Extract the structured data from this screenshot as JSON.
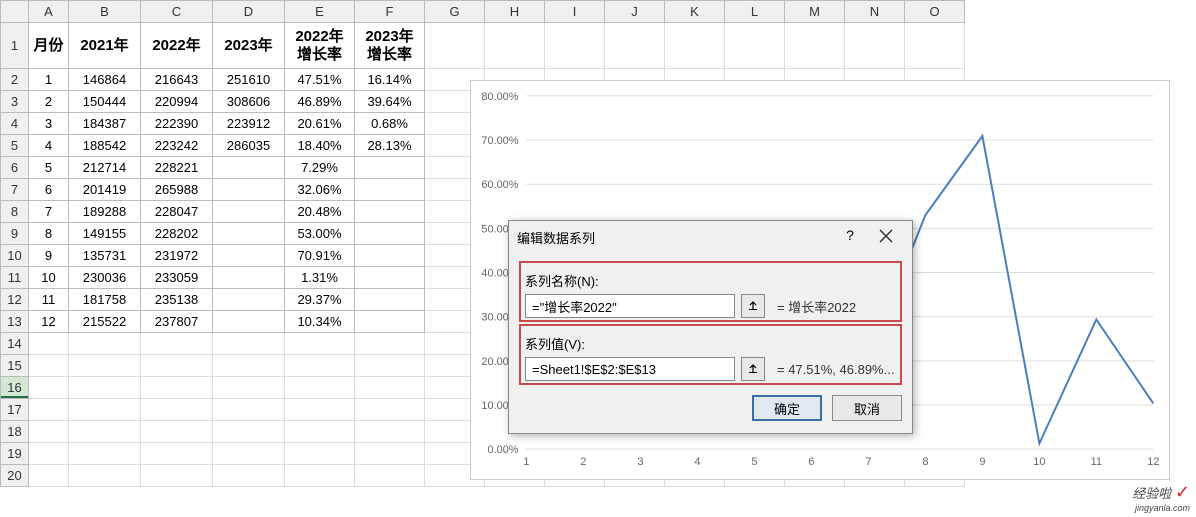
{
  "columns": [
    "A",
    "B",
    "C",
    "D",
    "E",
    "F",
    "G",
    "H",
    "I",
    "J",
    "K",
    "L",
    "M",
    "N",
    "O"
  ],
  "headers": [
    "月份",
    "2021年",
    "2022年",
    "2023年",
    "2022年\n增长率",
    "2023年\n增长率"
  ],
  "rows": [
    [
      "1",
      "146864",
      "216643",
      "251610",
      "47.51%",
      "16.14%"
    ],
    [
      "2",
      "150444",
      "220994",
      "308606",
      "46.89%",
      "39.64%"
    ],
    [
      "3",
      "184387",
      "222390",
      "223912",
      "20.61%",
      "0.68%"
    ],
    [
      "4",
      "188542",
      "223242",
      "286035",
      "18.40%",
      "28.13%"
    ],
    [
      "5",
      "212714",
      "228221",
      "",
      "7.29%",
      ""
    ],
    [
      "6",
      "201419",
      "265988",
      "",
      "32.06%",
      ""
    ],
    [
      "7",
      "189288",
      "228047",
      "",
      "20.48%",
      ""
    ],
    [
      "8",
      "149155",
      "228202",
      "",
      "53.00%",
      ""
    ],
    [
      "9",
      "135731",
      "231972",
      "",
      "70.91%",
      ""
    ],
    [
      "10",
      "230036",
      "233059",
      "",
      "1.31%",
      ""
    ],
    [
      "11",
      "181758",
      "235138",
      "",
      "29.37%",
      ""
    ],
    [
      "12",
      "215522",
      "237807",
      "",
      "10.34%",
      ""
    ]
  ],
  "dialog": {
    "title": "编辑数据系列",
    "name_label": "系列名称(N):",
    "name_value": "=\"增长率2022\"",
    "name_preview": "= 增长率2022",
    "values_label": "系列值(V):",
    "values_value": "=Sheet1!$E$2:$E$13",
    "values_preview": "= 47.51%, 46.89%...",
    "ok": "确定",
    "cancel": "取消"
  },
  "chart_data": {
    "type": "line",
    "categories": [
      1,
      2,
      3,
      4,
      5,
      6,
      7,
      8,
      9,
      10,
      11,
      12
    ],
    "values": [
      47.51,
      46.89,
      20.61,
      18.4,
      7.29,
      32.06,
      20.48,
      53.0,
      70.91,
      1.31,
      29.37,
      10.34
    ],
    "y_ticks": [
      "0.00%",
      "10.00%",
      "20.00%",
      "30.00%",
      "40.00%",
      "50.00%",
      "60.00%",
      "70.00%",
      "80.00%"
    ],
    "ylim": [
      0,
      80
    ],
    "series_name": "增长率2022"
  },
  "watermark": {
    "main": "经验啦",
    "sub": "jingyanla.com"
  }
}
